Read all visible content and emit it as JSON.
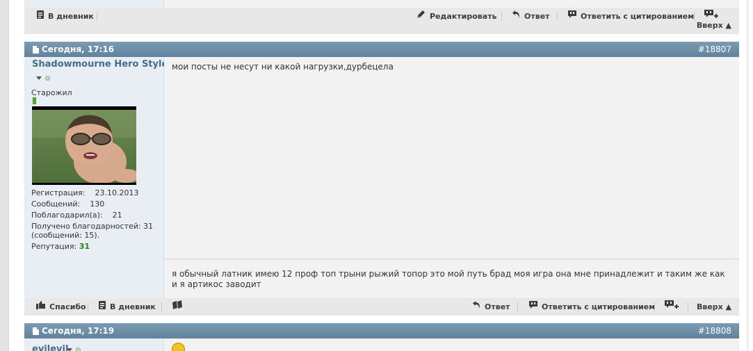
{
  "post_prev": {
    "footer": {
      "diary": "В дневник",
      "edit": "Редактировать",
      "reply": "Ответ",
      "reply_quote": "Ответить с цитированием",
      "top": "Вверх ▲"
    }
  },
  "post_1": {
    "date": "Сегодня, 17:16",
    "number": "#18807",
    "username": "Shadowmourne Hero Style",
    "user_title": "Старожил",
    "stats": {
      "reg_label": "Регистрация:",
      "reg_value": "23.10.2013",
      "posts_label": "Сообщений:",
      "posts_value": "130",
      "thanked_label": "Поблагодарил(а):",
      "thanked_value": "21",
      "thanks_received": "Получено благодарностей: 31 (сообщений: 15).",
      "rep_label": "Репутация:",
      "rep_value": "31"
    },
    "message": "мои посты не несут ни какой нагрузки,дурбецела",
    "signature": "я обычный латник имею 12 проф топ трыни рыжий топор это мой путь брад моя игра она мне принадлежит и таким же как и я артикос заводит",
    "footer": {
      "thanks": "Спасибо",
      "diary": "В дневник",
      "reply": "Ответ",
      "reply_quote": "Ответить с цитированием",
      "top": "Вверх ▲"
    }
  },
  "post_2": {
    "date": "Сегодня, 17:19",
    "number": "#18808",
    "username": "evilevil"
  },
  "colors": {
    "header_bar": "#6d8ea8",
    "username": "#456c8c",
    "reputation": "#2a7a1a",
    "user_panel": "#e9eef4",
    "post_body": "#f2f2f2",
    "footer_bar": "#e8e8e8"
  },
  "icons": {
    "diary": "notebook-icon",
    "edit": "pencil-icon",
    "reply": "reply-arrow-icon",
    "quote": "quote-bubble-icon",
    "multiquote": "multiquote-plus-icon",
    "thanks": "thumbs-up-icon",
    "report": "flag-icon",
    "date": "page-icon"
  }
}
